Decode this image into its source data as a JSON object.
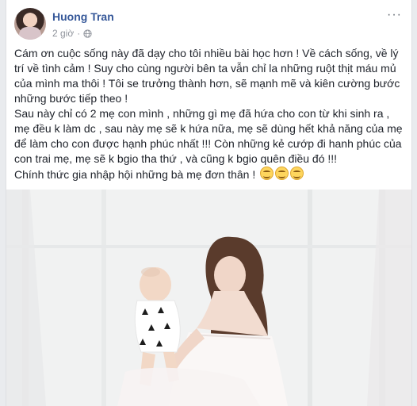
{
  "post": {
    "author_name": "Huong Tran",
    "time": "2 giờ",
    "privacy_icon": "globe-icon",
    "more_label": "···",
    "paragraph1": "Cám ơn cuộc sống này đã dạy cho tôi nhiều bài học hơn ! Về cách sống, về lý trí về tình cảm ! Suy cho cùng người bên ta vẫn chỉ la những ruột thịt máu mủ của mình ma thôi ! Tôi se trưởng thành hơn, sẽ mạnh mẽ và kiên cường bước những bước tiếp theo !",
    "paragraph2": "Sau này chỉ có 2 mẹ con mình , những gì mẹ đã hứa cho con từ khi sinh ra , mẹ đều k làm dc , sau này mẹ sẽ k hứa nữa, mẹ sẽ dùng hết khả năng của mẹ để làm cho con được hạnh phúc nhất !!! Còn những kẻ cướp đi hanh phúc của con trai mẹ, mẹ sẽ k bgio tha thứ , và cũng k bgio quên điều đó !!!",
    "paragraph3": "Chính thức gia nhập hội những bà mẹ đơn thân !",
    "emoji_icons": [
      "smiling-face-icon",
      "smiling-face-icon",
      "smiling-face-icon"
    ],
    "photo_icon": "mother-and-baby-photo"
  }
}
